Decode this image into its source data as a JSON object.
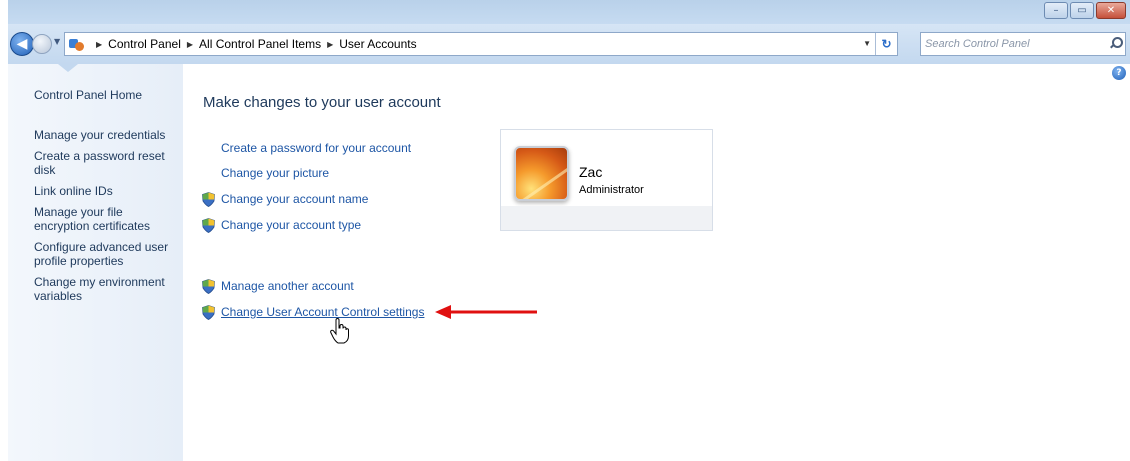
{
  "window": {
    "controls": {
      "minimize": "–",
      "maximize": "▭",
      "close": "✕"
    }
  },
  "address_bar": {
    "crumbs": [
      "Control Panel",
      "All Control Panel Items",
      "User Accounts"
    ],
    "search_placeholder": "Search Control Panel"
  },
  "left_nav": {
    "home": "Control Panel Home",
    "items": [
      "Manage your credentials",
      "Create a password reset disk",
      "Link online IDs",
      "Manage your file encryption certificates",
      "Configure advanced user profile properties",
      "Change my environment variables"
    ]
  },
  "main": {
    "title": "Make changes to your user account",
    "tasks": [
      {
        "label": "Create a password for your account",
        "shield": false
      },
      {
        "label": "Change your picture",
        "shield": false
      },
      {
        "label": "Change your account name",
        "shield": true
      },
      {
        "label": "Change your account type",
        "shield": true
      }
    ],
    "other_tasks": [
      {
        "label": "Manage another account",
        "shield": true
      },
      {
        "label": "Change User Account Control settings",
        "shield": true,
        "hovered": true
      }
    ]
  },
  "account": {
    "name": "Zac",
    "role": "Administrator"
  },
  "colors": {
    "link": "#1e56a5",
    "annotation_arrow": "#e01010"
  },
  "icons": {
    "help": "?"
  }
}
